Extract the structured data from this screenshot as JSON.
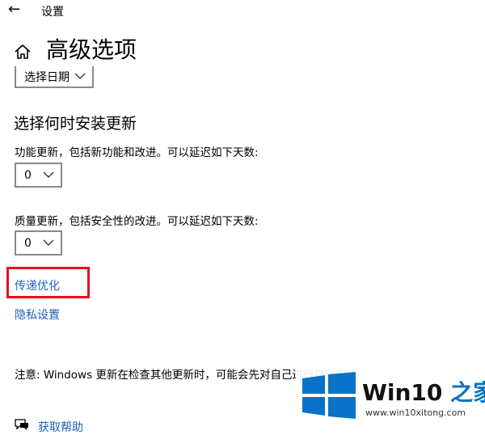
{
  "header": {
    "back_icon": "back-arrow-icon",
    "app_title": "设置"
  },
  "page": {
    "home_icon": "home-icon",
    "title": "高级选项"
  },
  "date_select": {
    "value": "选择日期"
  },
  "install_section": {
    "heading": "选择何时安装更新",
    "feature_label": "功能更新，包括新功能和改进。可以延迟如下天数:",
    "feature_value": "0",
    "quality_label": "质量更新，包括安全性的改进。可以延迟如下天数:",
    "quality_value": "0"
  },
  "links": {
    "delivery_optimization": "传递优化",
    "privacy_settings": "隐私设置"
  },
  "note": "注意: Windows 更新在检查其他更新时，可能会先对自己进行自动更新",
  "help": {
    "icon": "help-chat-icon",
    "label": "获取帮助"
  },
  "watermark": {
    "brand_prefix": "Win10",
    "brand_suffix": "之家",
    "url": "www.win10xitong.com"
  },
  "colors": {
    "link": "#1a63b8",
    "highlight": "#e3111b",
    "logo_blue": "#0a72c8"
  }
}
